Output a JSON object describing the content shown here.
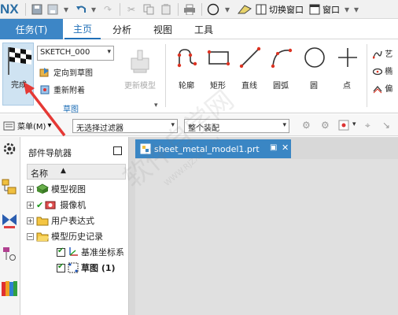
{
  "app": {
    "logo": "NX"
  },
  "titlebar": {
    "switch_window": "切换窗口",
    "window_menu": "窗口"
  },
  "tabs": {
    "task": "任务(T)",
    "items": [
      "主页",
      "分析",
      "视图",
      "工具"
    ]
  },
  "ribbon": {
    "finish": "完成",
    "sketch_name": "SKETCH_000",
    "orient_to_sketch": "定向到草图",
    "reattach": "重新附着",
    "update_model": "更新模型",
    "group_label": "草图",
    "tools": [
      "轮廓",
      "矩形",
      "直线",
      "圆弧",
      "圆",
      "点"
    ],
    "side_tools": [
      "艺",
      "椭",
      "偏"
    ]
  },
  "filterbar": {
    "menu": "菜单(M)",
    "filter": "无选择过滤器",
    "scope": "整个装配"
  },
  "navigator": {
    "title": "部件导航器",
    "column_name": "名称",
    "tree": [
      {
        "label": "模型视图",
        "expander": "+"
      },
      {
        "label": "摄像机",
        "expander": "+"
      },
      {
        "label": "用户表达式",
        "expander": "+"
      },
      {
        "label": "模型历史记录",
        "expander": "−"
      },
      {
        "label": "基准坐标系",
        "expander": ""
      },
      {
        "label": "草图 (1)",
        "expander": ""
      }
    ]
  },
  "document": {
    "tab_title": "sheet_metal_model1.prt"
  },
  "watermark": {
    "text": "软件自学网",
    "url": "WWW.RJZXW.COM"
  },
  "colors": {
    "accent": "#3d86c6",
    "arrow": "#e53935"
  }
}
